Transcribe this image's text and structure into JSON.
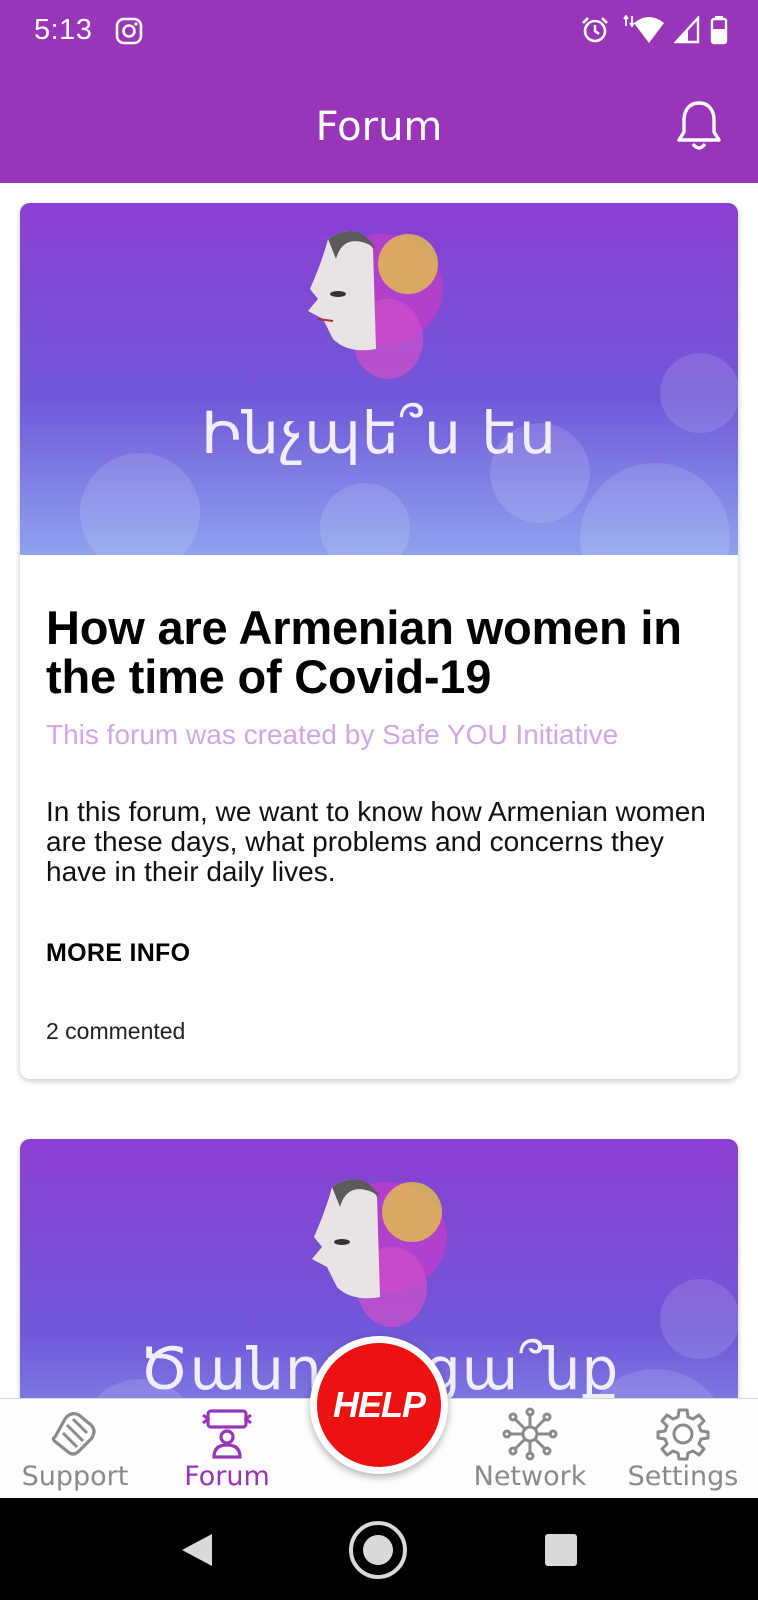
{
  "status_bar": {
    "time": "5:13",
    "icons": [
      "instagram-icon",
      "alarm-icon",
      "wifi-icon",
      "signal-icon",
      "battery-icon"
    ]
  },
  "app_bar": {
    "title": "Forum",
    "action_icon": "bell-icon"
  },
  "colors": {
    "primary": "#9935b8",
    "help": "#ee1111",
    "creator_text": "#d3a6e6"
  },
  "forums": [
    {
      "banner_text": "Ինչպե՞ս ես",
      "title": "How are Armenian women in the time of Covid-19",
      "creator": "This forum was created by Safe YOU Initiative",
      "description": "In this forum, we want to know how Armenian women are these days, what problems and concerns they have in their daily lives.",
      "more_info": "MORE INFO",
      "comments": "2 commented"
    },
    {
      "banner_text": "Ծանոթացա՞նք"
    }
  ],
  "bottom_nav": {
    "items": [
      {
        "label": "Support",
        "icon": "handshake-icon"
      },
      {
        "label": "Forum",
        "icon": "forum-icon",
        "active": true
      },
      {
        "label": "Network",
        "icon": "network-icon"
      },
      {
        "label": "Settings",
        "icon": "gear-icon"
      }
    ],
    "help_label": "HELP"
  },
  "system_nav": {
    "icons": [
      "back-icon",
      "home-icon",
      "recents-icon"
    ]
  }
}
